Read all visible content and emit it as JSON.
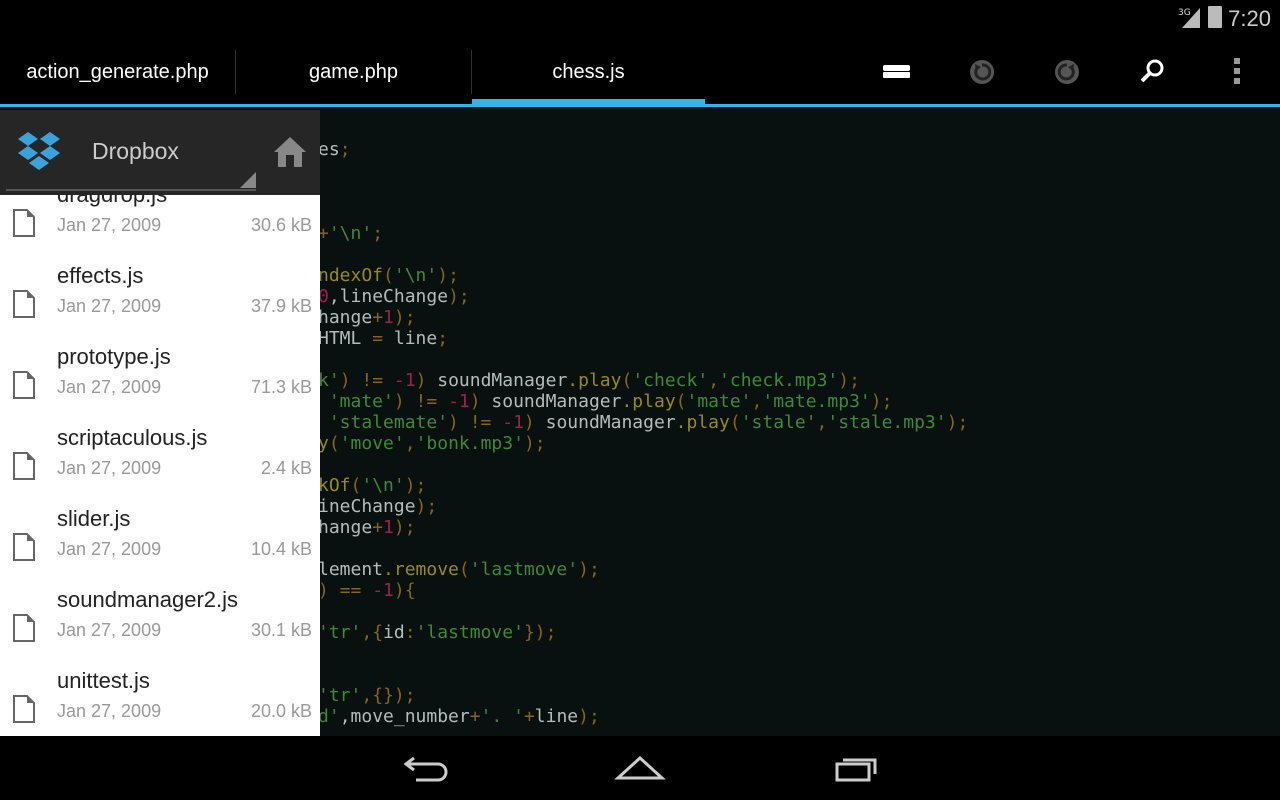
{
  "status_bar": {
    "network": "3G",
    "time": "7:20"
  },
  "tabs": [
    {
      "label": "action_generate.php",
      "active": false
    },
    {
      "label": "game.php",
      "active": false
    },
    {
      "label": "chess.js",
      "active": true
    }
  ],
  "toolbar": {
    "icons": [
      "drive-icon",
      "undo-icon",
      "redo-icon",
      "search-icon",
      "overflow-menu-icon"
    ]
  },
  "accent_color": "#33b5e5",
  "file_panel": {
    "title": "Dropbox",
    "files": [
      {
        "name": "dragdrop.js",
        "date": "Jan 27, 2009",
        "size": "30.6 kB"
      },
      {
        "name": "effects.js",
        "date": "Jan 27, 2009",
        "size": "37.9 kB"
      },
      {
        "name": "prototype.js",
        "date": "Jan 27, 2009",
        "size": "71.3 kB"
      },
      {
        "name": "scriptaculous.js",
        "date": "Jan 27, 2009",
        "size": "2.4 kB"
      },
      {
        "name": "slider.js",
        "date": "Jan 27, 2009",
        "size": "10.4 kB"
      },
      {
        "name": "soundmanager2.js",
        "date": "Jan 27, 2009",
        "size": "30.1 kB"
      },
      {
        "name": "unittest.js",
        "date": "Jan 27, 2009",
        "size": "20.0 kB"
      }
    ]
  },
  "code_colors": {
    "p": "#b4bcbc",
    "s": "#3e8a3a",
    "m": "#9a8a1e",
    "o": "#8a6418",
    "n": "#a0204a"
  },
  "code_lines": [
    {
      "row": 0,
      "tokens": [
        [
          "es",
          "p"
        ],
        [
          ";",
          "o"
        ]
      ]
    },
    {
      "row": 4,
      "tokens": [
        [
          "+",
          "o"
        ],
        [
          "'\\n'",
          "s"
        ],
        [
          ";",
          "o"
        ]
      ]
    },
    {
      "row": 6,
      "tokens": [
        [
          "ndexOf",
          "m"
        ],
        [
          "(",
          "o"
        ],
        [
          "'\\n'",
          "s"
        ],
        [
          ");",
          "o"
        ]
      ]
    },
    {
      "row": 7,
      "tokens": [
        [
          "0",
          "n"
        ],
        [
          ",lineChange",
          "p"
        ],
        [
          ");",
          "o"
        ]
      ]
    },
    {
      "row": 8,
      "tokens": [
        [
          "hange",
          "p"
        ],
        [
          "+",
          "o"
        ],
        [
          "1",
          "n"
        ],
        [
          ");",
          "o"
        ]
      ]
    },
    {
      "row": 9,
      "tokens": [
        [
          "HTML ",
          "p"
        ],
        [
          "=",
          "o"
        ],
        [
          " line",
          "p"
        ],
        [
          ";",
          "o"
        ]
      ]
    },
    {
      "row": 11,
      "tokens": [
        [
          "k'",
          "s"
        ],
        [
          ") != ",
          "o"
        ],
        [
          "-1",
          "n"
        ],
        [
          ")",
          "o"
        ],
        [
          " soundManager",
          "p"
        ],
        [
          ".play",
          "m"
        ],
        [
          "(",
          "o"
        ],
        [
          "'check'",
          "s"
        ],
        [
          ",",
          "o"
        ],
        [
          "'check.mp3'",
          "s"
        ],
        [
          ");",
          "o"
        ]
      ]
    },
    {
      "row": 12,
      "tokens": [
        [
          " 'mate'",
          "s"
        ],
        [
          ") != ",
          "o"
        ],
        [
          "-1",
          "n"
        ],
        [
          ")",
          "o"
        ],
        [
          " soundManager",
          "p"
        ],
        [
          ".play",
          "m"
        ],
        [
          "(",
          "o"
        ],
        [
          "'mate'",
          "s"
        ],
        [
          ",",
          "o"
        ],
        [
          "'mate.mp3'",
          "s"
        ],
        [
          ");",
          "o"
        ]
      ]
    },
    {
      "row": 13,
      "tokens": [
        [
          " 'stalemate'",
          "s"
        ],
        [
          ") != ",
          "o"
        ],
        [
          "-1",
          "n"
        ],
        [
          ")",
          "o"
        ],
        [
          " soundManager",
          "p"
        ],
        [
          ".play",
          "m"
        ],
        [
          "(",
          "o"
        ],
        [
          "'stale'",
          "s"
        ],
        [
          ",",
          "o"
        ],
        [
          "'stale.mp3'",
          "s"
        ],
        [
          ");",
          "o"
        ]
      ]
    },
    {
      "row": 14,
      "tokens": [
        [
          "y",
          "m"
        ],
        [
          "(",
          "o"
        ],
        [
          "'move'",
          "s"
        ],
        [
          ",",
          "o"
        ],
        [
          "'bonk.mp3'",
          "s"
        ],
        [
          ");",
          "o"
        ]
      ]
    },
    {
      "row": 16,
      "tokens": [
        [
          "kOf",
          "m"
        ],
        [
          "(",
          "o"
        ],
        [
          "'\\n'",
          "s"
        ],
        [
          ");",
          "o"
        ]
      ]
    },
    {
      "row": 17,
      "tokens": [
        [
          "ineChange",
          "p"
        ],
        [
          ");",
          "o"
        ]
      ]
    },
    {
      "row": 18,
      "tokens": [
        [
          "hange",
          "p"
        ],
        [
          "+",
          "o"
        ],
        [
          "1",
          "n"
        ],
        [
          ");",
          "o"
        ]
      ]
    },
    {
      "row": 20,
      "tokens": [
        [
          "lement",
          "p"
        ],
        [
          ".remove",
          "m"
        ],
        [
          "(",
          "o"
        ],
        [
          "'lastmove'",
          "s"
        ],
        [
          ");",
          "o"
        ]
      ]
    },
    {
      "row": 21,
      "tokens": [
        [
          ") == ",
          "o"
        ],
        [
          "-1",
          "n"
        ],
        [
          "){",
          "o"
        ]
      ]
    },
    {
      "row": 23,
      "tokens": [
        [
          "'tr'",
          "s"
        ],
        [
          ",{",
          "o"
        ],
        [
          "id",
          "p"
        ],
        [
          ":",
          "o"
        ],
        [
          "'lastmove'",
          "s"
        ],
        [
          "});",
          "o"
        ]
      ]
    },
    {
      "row": 26,
      "tokens": [
        [
          "'tr'",
          "s"
        ],
        [
          ",{});",
          "o"
        ]
      ]
    },
    {
      "row": 27,
      "tokens": [
        [
          "d'",
          "s"
        ],
        [
          ",move_number",
          "p"
        ],
        [
          "+",
          "o"
        ],
        [
          "'. '",
          "s"
        ],
        [
          "+",
          "o"
        ],
        [
          "line",
          "p"
        ],
        [
          ");",
          "o"
        ]
      ]
    }
  ]
}
